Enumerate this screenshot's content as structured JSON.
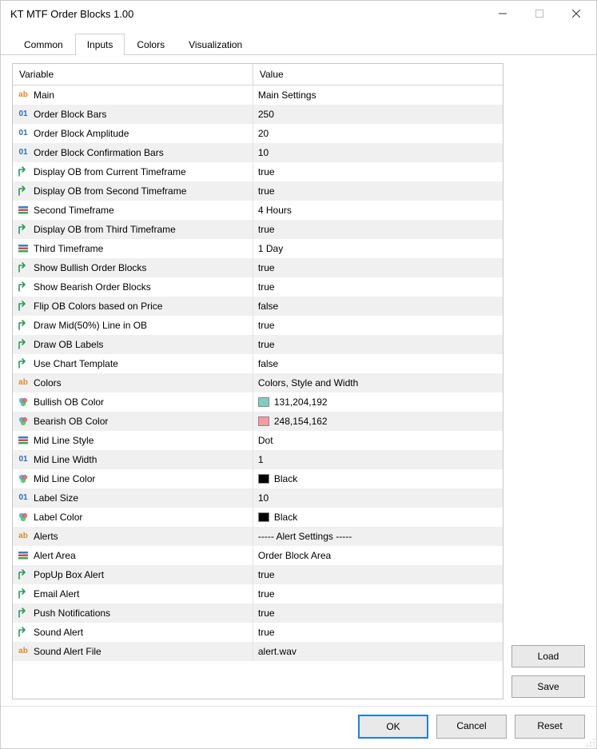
{
  "window": {
    "title": "KT MTF Order Blocks 1.00"
  },
  "tabs": {
    "items": [
      "Common",
      "Inputs",
      "Colors",
      "Visualization"
    ],
    "active_index": 1
  },
  "table": {
    "headers": {
      "variable": "Variable",
      "value": "Value"
    },
    "selected_index": 30,
    "rows": [
      {
        "icon": "ab",
        "name": "Main",
        "value": "Main Settings"
      },
      {
        "icon": "01",
        "name": "Order Block Bars",
        "value": "250"
      },
      {
        "icon": "01",
        "name": "Order Block Amplitude",
        "value": "20"
      },
      {
        "icon": "01",
        "name": "Order Block Confirmation Bars",
        "value": "10"
      },
      {
        "icon": "arrow",
        "name": "Display OB from Current Timeframe",
        "value": "true"
      },
      {
        "icon": "arrow",
        "name": "Display OB from Second Timeframe",
        "value": "true"
      },
      {
        "icon": "stack",
        "name": "Second Timeframe",
        "value": "4 Hours"
      },
      {
        "icon": "arrow",
        "name": "Display OB from Third Timeframe",
        "value": "true"
      },
      {
        "icon": "stack",
        "name": "Third Timeframe",
        "value": "1 Day"
      },
      {
        "icon": "arrow",
        "name": "Show Bullish Order Blocks",
        "value": "true"
      },
      {
        "icon": "arrow",
        "name": "Show Bearish Order Blocks",
        "value": "true"
      },
      {
        "icon": "arrow",
        "name": "Flip OB Colors based on Price",
        "value": "false"
      },
      {
        "icon": "arrow",
        "name": "Draw Mid(50%) Line in OB",
        "value": "true"
      },
      {
        "icon": "arrow",
        "name": "Draw OB Labels",
        "value": "true"
      },
      {
        "icon": "arrow",
        "name": "Use Chart Template",
        "value": "false"
      },
      {
        "icon": "ab",
        "name": "Colors",
        "value": "Colors, Style and Width"
      },
      {
        "icon": "color",
        "name": "Bullish OB Color",
        "value": "131,204,192",
        "swatch": "#83ccc0"
      },
      {
        "icon": "color",
        "name": "Bearish OB Color",
        "value": "248,154,162",
        "swatch": "#f89aa2"
      },
      {
        "icon": "stack",
        "name": "Mid Line Style",
        "value": "Dot"
      },
      {
        "icon": "01",
        "name": "Mid Line Width",
        "value": "1"
      },
      {
        "icon": "color",
        "name": "Mid Line Color",
        "value": "Black",
        "swatch": "#000000"
      },
      {
        "icon": "01",
        "name": "Label Size",
        "value": "10"
      },
      {
        "icon": "color",
        "name": "Label Color",
        "value": "Black",
        "swatch": "#000000"
      },
      {
        "icon": "ab",
        "name": "Alerts",
        "value": "----- Alert Settings -----"
      },
      {
        "icon": "stack",
        "name": "Alert Area",
        "value": "Order Block Area"
      },
      {
        "icon": "arrow",
        "name": "PopUp Box Alert",
        "value": "true"
      },
      {
        "icon": "arrow",
        "name": "Email Alert",
        "value": "true"
      },
      {
        "icon": "arrow",
        "name": "Push Notifications",
        "value": "true"
      },
      {
        "icon": "arrow",
        "name": "Sound Alert",
        "value": "true"
      },
      {
        "icon": "ab",
        "name": "Sound Alert File",
        "value": "alert.wav"
      }
    ]
  },
  "side_buttons": {
    "load": "Load",
    "save": "Save"
  },
  "bottom_buttons": {
    "ok": "OK",
    "cancel": "Cancel",
    "reset": "Reset"
  }
}
